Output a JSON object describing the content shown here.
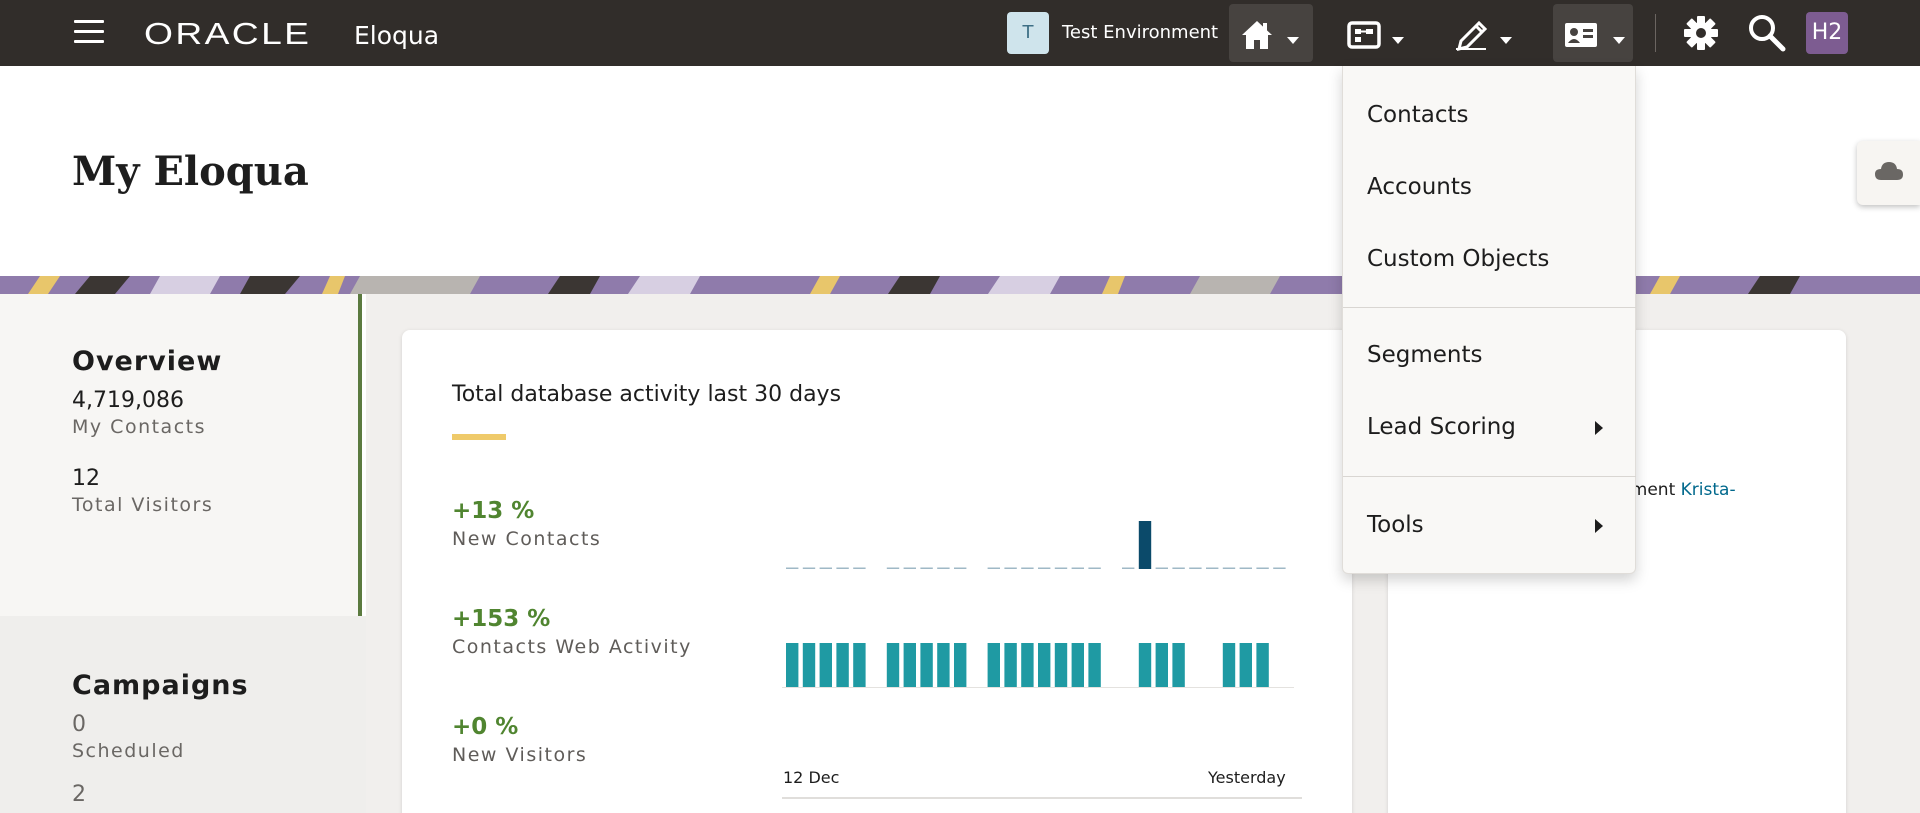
{
  "topbar": {
    "brand": "ORACLE",
    "app_name": "Eloqua",
    "environment": {
      "initial": "T",
      "name": "Test Environment"
    },
    "nav": [
      {
        "name": "home",
        "icon": "home-icon",
        "active": true
      },
      {
        "name": "orchestration",
        "icon": "orchestration-icon",
        "active": false
      },
      {
        "name": "assets",
        "icon": "pencil-icon",
        "active": false
      },
      {
        "name": "audience",
        "icon": "contact-card-icon",
        "active": true
      }
    ],
    "settings_icon": "gear-icon",
    "search_icon": "search-icon",
    "user_initials": "H2"
  },
  "page": {
    "title": "My Eloqua"
  },
  "overview": {
    "title": "Overview",
    "stats": [
      {
        "value": "4,719,086",
        "label": "My Contacts"
      },
      {
        "value": "12",
        "label": "Total Visitors"
      }
    ]
  },
  "campaigns": {
    "title": "Campaigns",
    "stats": [
      {
        "value": "0",
        "label": "Scheduled"
      },
      {
        "value": "2",
        "label": ""
      }
    ]
  },
  "activity_card": {
    "title": "Total database activity last 30 days",
    "metrics": [
      {
        "pct": "+13 %",
        "label": "New Contacts"
      },
      {
        "pct": "+153 %",
        "label": "Contacts Web Activity"
      },
      {
        "pct": "+0 %",
        "label": "New Visitors"
      }
    ],
    "x_start": "12 Dec",
    "x_end": "Yesterday"
  },
  "chart_data": {
    "type": "bar",
    "title": "",
    "series": [
      {
        "name": "New Contacts",
        "color": "#0b4a6a",
        "values": [
          0,
          0,
          0,
          0,
          0,
          null,
          0,
          0,
          0,
          0,
          0,
          null,
          0,
          0,
          0,
          0,
          0,
          0,
          0,
          null,
          0,
          1,
          0,
          0,
          0,
          0,
          0,
          0,
          0,
          0
        ]
      },
      {
        "name": "Contacts Web Activity",
        "color": "#1f9aa3",
        "values": [
          1,
          1,
          1,
          1,
          1,
          null,
          1,
          1,
          1,
          1,
          1,
          null,
          1,
          1,
          1,
          1,
          1,
          1,
          1,
          null,
          null,
          1,
          1,
          1,
          null,
          null,
          1,
          1,
          1,
          null
        ]
      },
      {
        "name": "New Visitors",
        "color": "#1f9aa3",
        "values": [
          0,
          0,
          0,
          0,
          0,
          0,
          0,
          0,
          0,
          0,
          0,
          0,
          0,
          0,
          0,
          0,
          0,
          0,
          0,
          0,
          0,
          0,
          0,
          0,
          0,
          0,
          0,
          0,
          0,
          0
        ]
      }
    ],
    "xlabel_start": "12 Dec",
    "xlabel_end": "Yesterday"
  },
  "segment_card": {
    "text_prefix": "gment",
    "link_text": "Krista-"
  },
  "dropdown": {
    "items": [
      {
        "label": "Contacts",
        "submenu": false
      },
      {
        "label": "Accounts",
        "submenu": false
      },
      {
        "label": "Custom Objects",
        "submenu": false
      },
      {
        "label": "Segments",
        "submenu": false
      },
      {
        "label": "Lead Scoring",
        "submenu": true
      },
      {
        "label": "Tools",
        "submenu": true
      }
    ]
  },
  "colors": {
    "topbar": "#312d2a",
    "accent_green": "#508530",
    "overview_border": "#5b7a3f",
    "card_accent": "#efca6a",
    "avatar": "#7d5c91",
    "link": "#00688c"
  }
}
